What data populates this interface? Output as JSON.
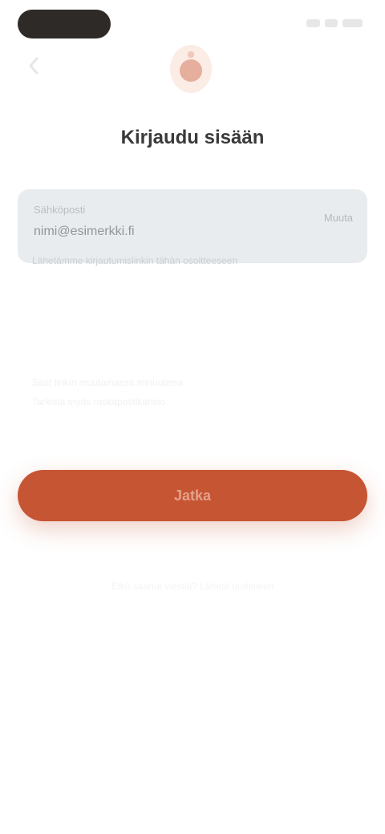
{
  "colors": {
    "accent": "#c65533",
    "card_background": "#e9ecee",
    "title_text": "#3a3a3a"
  },
  "status_bar": {
    "icons": [
      "signal-icon",
      "wifi-icon",
      "battery-icon"
    ]
  },
  "header": {
    "back_icon": "chevron-left-icon",
    "logo_icon": "app-logo-icon",
    "title": "Kirjaudu sisään"
  },
  "card": {
    "label": "Sähköposti",
    "value": "nimi@esimerkki.fi",
    "action": "Muuta",
    "hint": "Lähetämme kirjautumislinkin tähän osoitteeseen"
  },
  "helper": {
    "line_1": "Saat linkin muutamassa minuutissa",
    "line_2": "Tarkista myös roskapostikansio"
  },
  "primary_action": {
    "label": "Jatka"
  },
  "footer": {
    "text": "Etkö saanut viestiä? Lähetä uudelleen"
  }
}
